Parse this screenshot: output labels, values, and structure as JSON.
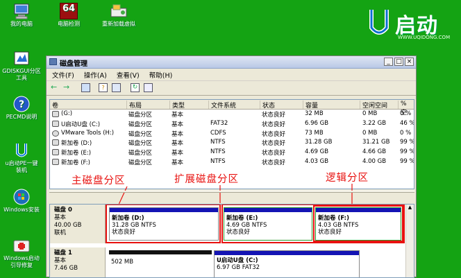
{
  "desktop": {
    "icons": [
      {
        "label": "我的电脑",
        "icon": "computer-icon"
      },
      {
        "label": "电脑检测",
        "icon": "test-64-icon",
        "badge": "64"
      },
      {
        "label": "重新加载\n虚拟驱动",
        "icon": "reload-driver-icon",
        "display": "重新加载虚拟"
      },
      {
        "label": "GDISKGUI分区\n工具",
        "icon": "disk-partition-icon"
      },
      {
        "label": "PECMD说明",
        "icon": "help-icon"
      },
      {
        "label": "u启动PE一键\n装机",
        "icon": "install-icon"
      },
      {
        "label": "Windows安装",
        "icon": "windows-setup-icon"
      },
      {
        "label": "Windows启动\n引导修复",
        "icon": "boot-repair-icon"
      }
    ],
    "logo": {
      "text": "启动",
      "url": "WWW.UQIDONG.COM",
      "accent": "#14a313"
    }
  },
  "window": {
    "title": "磁盘管理",
    "menu": [
      "文件(F)",
      "操作(A)",
      "查看(V)",
      "帮助(H)"
    ],
    "columns": [
      "卷",
      "布局",
      "类型",
      "文件系统",
      "状态",
      "容量",
      "空闲空间",
      "% 空"
    ],
    "rows": [
      {
        "vol": "(G:)",
        "layout": "磁盘分区",
        "type": "基本",
        "fs": "",
        "status": "状态良好",
        "cap": "32 MB",
        "free": "0 MB",
        "pct": "0 %"
      },
      {
        "vol": "U启动U盘 (C:)",
        "layout": "磁盘分区",
        "type": "基本",
        "fs": "FAT32",
        "status": "状态良好",
        "cap": "6.96 GB",
        "free": "3.22 GB",
        "pct": "46 %"
      },
      {
        "vol": "VMware Tools (H:)",
        "layout": "磁盘分区",
        "type": "基本",
        "fs": "CDFS",
        "status": "状态良好",
        "cap": "73 MB",
        "free": "0 MB",
        "pct": "0 %"
      },
      {
        "vol": "新加卷 (D:)",
        "layout": "磁盘分区",
        "type": "基本",
        "fs": "NTFS",
        "status": "状态良好",
        "cap": "31.28 GB",
        "free": "31.21 GB",
        "pct": "99 %"
      },
      {
        "vol": "新加卷 (E:)",
        "layout": "磁盘分区",
        "type": "基本",
        "fs": "NTFS",
        "status": "状态良好",
        "cap": "4.69 GB",
        "free": "4.66 GB",
        "pct": "99 %"
      },
      {
        "vol": "新加卷 (F:)",
        "layout": "磁盘分区",
        "type": "基本",
        "fs": "NTFS",
        "status": "状态良好",
        "cap": "4.03 GB",
        "free": "4.00 GB",
        "pct": "99 %"
      }
    ],
    "annotations": {
      "primary": "主磁盘分区",
      "extended": "扩展磁盘分区",
      "logical": "逻辑分区",
      "color": "#e8110f"
    },
    "disk0": {
      "title": "磁盘 0",
      "type": "基本",
      "size": "40.00 GB",
      "state": "联机",
      "parts": [
        {
          "name": "新加卷 (D:)",
          "detail": "31.28 GB NTFS",
          "status": "状态良好"
        },
        {
          "name": "新加卷 (E:)",
          "detail": "4.69 GB NTFS",
          "status": "状态良好"
        },
        {
          "name": "新加卷 (F:)",
          "detail": "4.03 GB NTFS",
          "status": "状态良好"
        }
      ]
    },
    "disk1": {
      "title": "磁盘 1",
      "type": "基本",
      "size": "7.46 GB",
      "parts": [
        {
          "name": "",
          "detail": "502 MB"
        },
        {
          "name": "U启动U盘 (C:)",
          "detail": "6.97 GB FAT32"
        }
      ]
    }
  }
}
